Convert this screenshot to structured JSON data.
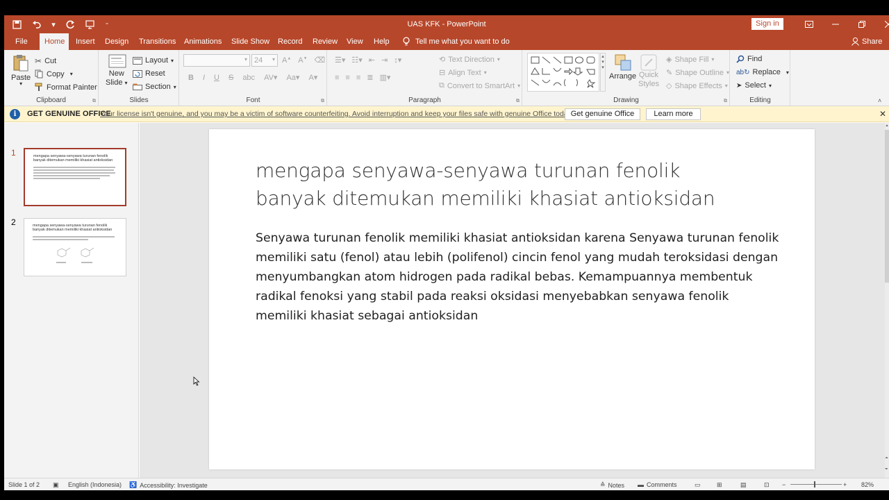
{
  "window": {
    "title": "UAS KFK  -  PowerPoint",
    "sign_in": "Sign in"
  },
  "tabs": [
    "File",
    "Home",
    "Insert",
    "Design",
    "Transitions",
    "Animations",
    "Slide Show",
    "Record",
    "Review",
    "View",
    "Help"
  ],
  "tell_me": "Tell me what you want to do",
  "share": "Share",
  "ribbon": {
    "clipboard": {
      "paste": "Paste",
      "cut": "Cut",
      "copy": "Copy",
      "format_painter": "Format Painter",
      "label": "Clipboard"
    },
    "slides": {
      "new_slide_1": "New",
      "new_slide_2": "Slide",
      "layout": "Layout",
      "reset": "Reset",
      "section": "Section",
      "label": "Slides"
    },
    "font": {
      "size": "24",
      "label": "Font",
      "bold": "B",
      "italic": "I",
      "underline": "U",
      "strike": "S"
    },
    "paragraph": {
      "text_direction": "Text Direction",
      "align_text": "Align Text",
      "convert_smartart": "Convert to SmartArt",
      "label": "Paragraph"
    },
    "drawing": {
      "arrange": "Arrange",
      "quick_1": "Quick",
      "quick_2": "Styles",
      "shape_fill": "Shape Fill",
      "shape_outline": "Shape Outline",
      "shape_effects": "Shape Effects",
      "label": "Drawing"
    },
    "editing": {
      "find": "Find",
      "replace": "Replace",
      "select": "Select",
      "label": "Editing"
    }
  },
  "notification": {
    "title": "GET GENUINE OFFICE",
    "message": "Your license isn't genuine, and you may be a victim of software counterfeiting. Avoid interruption and keep your files safe with genuine Office today.",
    "btn_genuine": "Get genuine Office",
    "btn_learn": "Learn more"
  },
  "thumbnails": [
    {
      "num": "1",
      "title": "mengapa senyawa-senyawa turunan fenolik banyak ditemukan memiliki khasiat antioksidan"
    },
    {
      "num": "2",
      "title": "mengapa senyawa-senyawa turunan fenolik banyak ditemukan memiliki khasiat antioksidan"
    }
  ],
  "slide": {
    "title_line1": "mengapa senyawa-senyawa turunan fenolik",
    "title_line2": "banyak ditemukan memiliki khasiat antioksidan",
    "body": "Senyawa turunan fenolik memiliki khasiat antioksidan karena Senyawa turunan fenolik memiliki satu (fenol) atau lebih (polifenol) cincin fenol yang mudah teroksidasi dengan menyumbangkan atom hidrogen pada radikal bebas. Kemampuannya membentuk radikal fenoksi yang stabil pada reaksi oksidasi menyebabkan senyawa fenolik memiliki khasiat sebagai antioksidan"
  },
  "status": {
    "slide_of": "Slide 1 of 2",
    "language": "English (Indonesia)",
    "accessibility": "Accessibility: Investigate",
    "notes": "Notes",
    "comments": "Comments",
    "zoom": "82%"
  },
  "colors": {
    "accent": "#b7472a",
    "notif_bg": "#fff4ce"
  }
}
